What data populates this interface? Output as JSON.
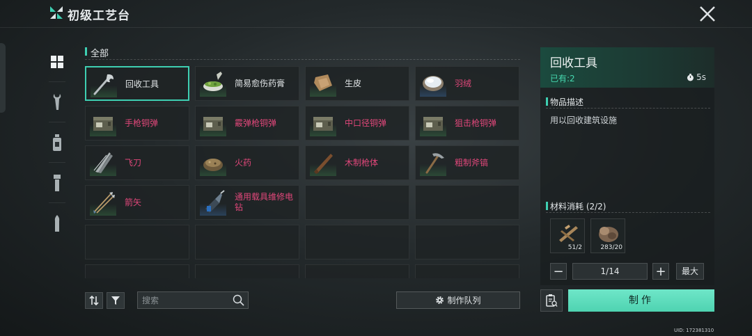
{
  "header": {
    "title": "初级工艺台"
  },
  "section": {
    "label": "全部"
  },
  "sidebar": {
    "items": [
      {
        "icon": "grid-icon",
        "active": true
      },
      {
        "icon": "wrench-icon",
        "active": false
      },
      {
        "icon": "bottle-icon",
        "active": false
      },
      {
        "icon": "flashlight-icon",
        "active": false
      },
      {
        "icon": "bullet-icon",
        "active": false
      }
    ]
  },
  "items": [
    {
      "name": "回收工具",
      "color": "white",
      "icon": "wrench-tool-icon",
      "selected": true
    },
    {
      "name": "简易愈伤药膏",
      "color": "white",
      "icon": "mortar-icon"
    },
    {
      "name": "生皮",
      "color": "white",
      "icon": "hide-icon"
    },
    {
      "name": "羽绒",
      "color": "pink",
      "icon": "down-feather-icon",
      "rarity": "blue"
    },
    {
      "name": "手枪铜弹",
      "color": "pink",
      "icon": "ammo-box-icon"
    },
    {
      "name": "霰弹枪铜弹",
      "color": "pink",
      "icon": "ammo-box-icon"
    },
    {
      "name": "中口径铜弹",
      "color": "pink",
      "icon": "ammo-box-icon"
    },
    {
      "name": "狙击枪铜弹",
      "color": "pink",
      "icon": "ammo-box-icon"
    },
    {
      "name": "飞刀",
      "color": "pink",
      "icon": "throwing-knife-icon"
    },
    {
      "name": "火药",
      "color": "pink",
      "icon": "gunpowder-icon"
    },
    {
      "name": "木制枪体",
      "color": "pink",
      "icon": "wooden-stock-icon"
    },
    {
      "name": "粗制斧镐",
      "color": "pink",
      "icon": "pickaxe-icon"
    },
    {
      "name": "箭矢",
      "color": "pink",
      "icon": "arrows-icon"
    },
    {
      "name": "通用载具维修电钻",
      "color": "pink",
      "icon": "drill-icon",
      "rarity": "blue"
    }
  ],
  "search": {
    "placeholder": "搜索"
  },
  "queue_button": "制作队列",
  "detail": {
    "title": "回收工具",
    "owned": "已有:2",
    "time": "5s",
    "desc_header": "物品描述",
    "desc": "用以回收建筑设施",
    "materials_header": "材料消耗 (2/2)",
    "materials": [
      {
        "icon": "wood-plank-icon",
        "count": "51/2"
      },
      {
        "icon": "stone-icon",
        "count": "283/20"
      }
    ],
    "quantity": "1/14",
    "max_label": "最大",
    "minus_label": "−",
    "plus_label": "+"
  },
  "craft_button": "制作",
  "uid": "UID: 172381310",
  "colors": {
    "accent": "#3ecfb2",
    "pink": "#e0477a",
    "craft": "#5fdcbc"
  }
}
